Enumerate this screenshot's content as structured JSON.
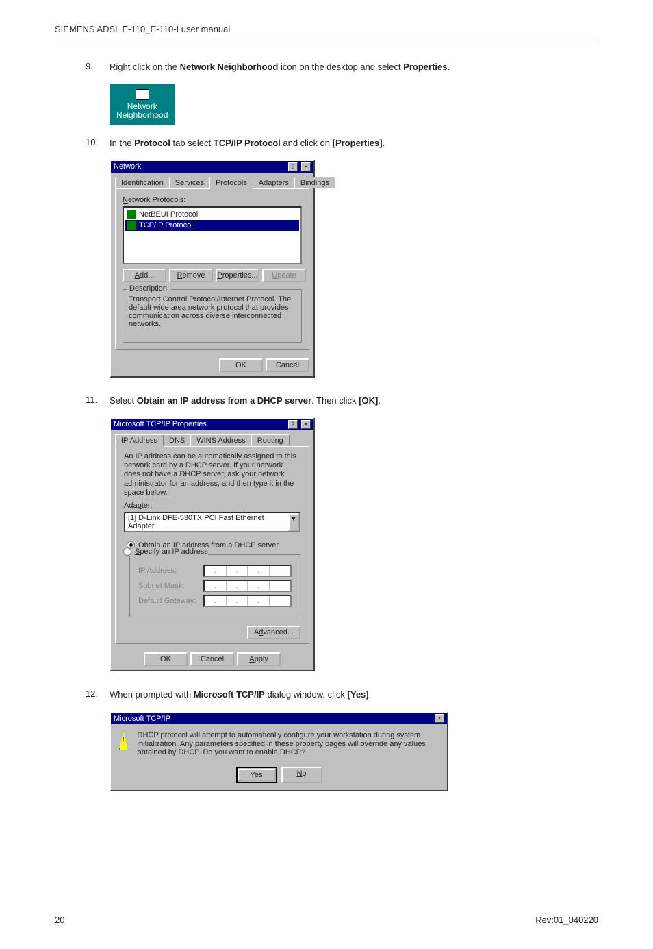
{
  "header": "SIEMENS ADSL E-110_E-110-I user manual",
  "steps": {
    "s9": {
      "num": "9.",
      "pre": "Right click on the ",
      "b1": "Network Neighborhood",
      "mid": " icon on the desktop and select ",
      "b2": "Properties",
      "post": "."
    },
    "s10": {
      "num": "10.",
      "pre": "In the ",
      "b1": "Protocol",
      "mid1": " tab select ",
      "b2": "TCP/IP Protocol",
      "mid2": " and click on ",
      "b3": "[Properties]",
      "post": "."
    },
    "s11": {
      "num": "11.",
      "pre": "Select ",
      "b1": "Obtain an IP address from a DHCP server",
      "mid": ". Then click ",
      "b2": "[OK]",
      "post": "."
    },
    "s12": {
      "num": "12.",
      "pre": "When prompted with ",
      "b1": "Microsoft TCP/IP",
      "mid": " dialog window, click ",
      "b2": "[Yes]",
      "post": "."
    }
  },
  "nn_icon": {
    "line1": "Network",
    "line2": "Neighborhood"
  },
  "net_dialog": {
    "title": "Network",
    "close_help": "?",
    "close_x": "×",
    "tabs": {
      "identification": "Identification",
      "services": "Services",
      "protocols": "Protocols",
      "adapters": "Adapters",
      "bindings": "Bindings"
    },
    "protocols_label": "Network Protocols:",
    "items": {
      "netbeui": "NetBEUI Protocol",
      "tcpip": "TCP/IP Protocol"
    },
    "buttons": {
      "add": "Add...",
      "remove": "Remove",
      "properties": "Properties...",
      "update": "Update"
    },
    "description_label": "Description:",
    "description": "Transport Control Protocol/Internet Protocol. The default wide area network protocol that provides communication across diverse interconnected networks.",
    "ok": "OK",
    "cancel": "Cancel"
  },
  "tcpip_dialog": {
    "title": "Microsoft TCP/IP Properties",
    "tabs": {
      "ip": "IP Address",
      "dns": "DNS",
      "wins": "WINS Address",
      "routing": "Routing"
    },
    "note": "An IP address can be automatically assigned to this network card by a DHCP server. If your network does not have a DHCP server, ask your network administrator for an address, and then type it in the space below.",
    "adapter_label": "Adapter:",
    "adapter_value": "[1] D-Link DFE-530TX PCI Fast Ethernet Adapter",
    "radio_obtain": "Obtain an IP address from a DHCP server",
    "radio_specify": "Specify an IP address",
    "ip_label": "IP Address:",
    "subnet_label": "Subnet Mask:",
    "gateway_label": "Default Gateway:",
    "advanced": "Advanced...",
    "ok": "OK",
    "cancel": "Cancel",
    "apply": "Apply"
  },
  "msg_dialog": {
    "title": "Microsoft TCP/IP",
    "text": "DHCP protocol will attempt to automatically configure your workstation during system initialization. Any parameters specified in these property pages will override any values obtained by DHCP. Do you want to enable DHCP?",
    "yes": "Yes",
    "no": "No"
  },
  "footer": {
    "page": "20",
    "rev": "Rev:01_040220"
  }
}
